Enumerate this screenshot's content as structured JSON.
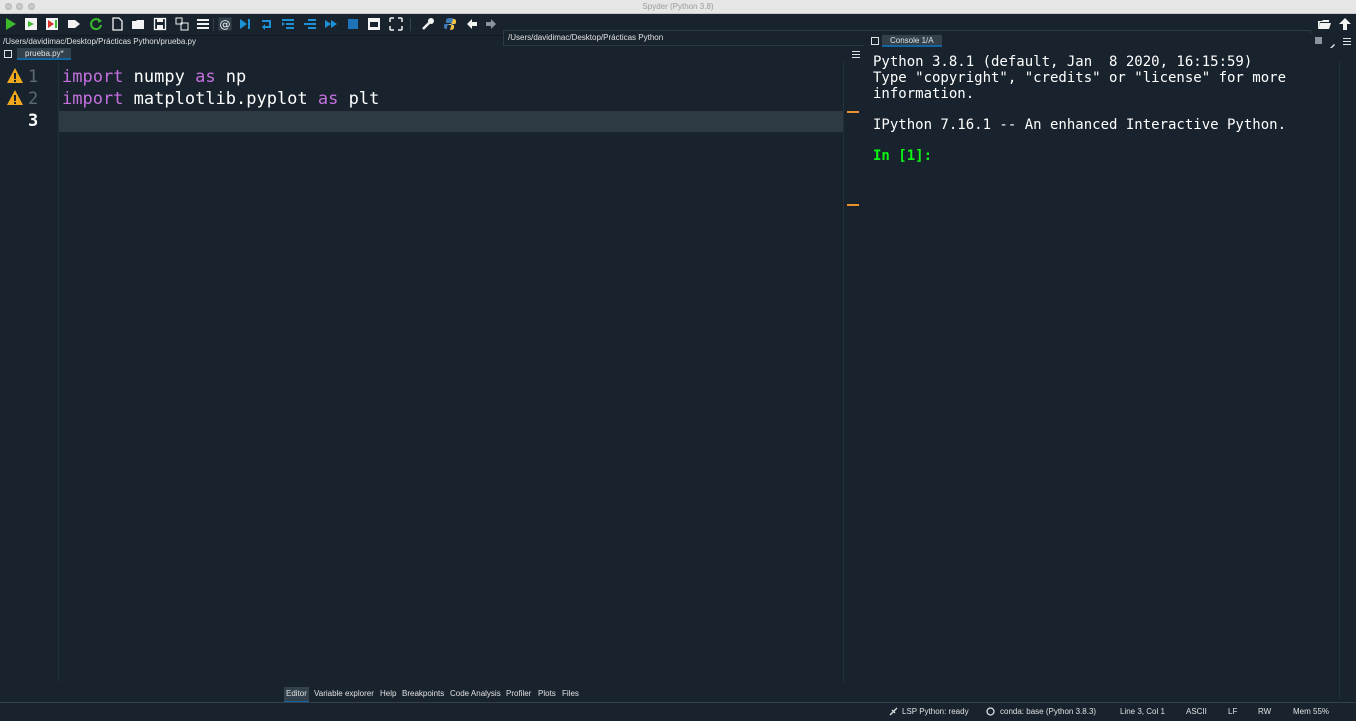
{
  "window": {
    "title": "Spyder (Python 3.8)"
  },
  "toolbar": {
    "path": "/Users/davidimac/Desktop/Prácticas Python",
    "colors": {
      "run": "#3bba2b",
      "debug": "#1d91d6",
      "stop": "#1d72b8",
      "python": "#f6c344"
    }
  },
  "editor": {
    "file_path": "/Users/davidimac/Desktop/Prácticas Python/prueba.py",
    "tab_label": "prueba.py*",
    "lines": [
      {
        "number": "1",
        "warning": true,
        "t1": "import",
        "t2": " numpy ",
        "t3": "as",
        "t4": " np"
      },
      {
        "number": "2",
        "warning": true,
        "t1": "import",
        "t2": " matplotlib.pyplot ",
        "t3": "as",
        "t4": " plt"
      },
      {
        "number": "3",
        "warning": false,
        "t1": "",
        "t2": "",
        "t3": "",
        "t4": ""
      }
    ],
    "colors": {
      "keyword": "#c670e0",
      "marker": "#e8922b",
      "warning": "#f0a81c"
    }
  },
  "console": {
    "tab_label": "Console 1/A",
    "lines": [
      "Python 3.8.1 (default, Jan  8 2020, 16:15:59)",
      "Type \"copyright\", \"credits\" or \"license\" for more",
      "information.",
      "IPython 7.16.1 -- An enhanced Interactive Python."
    ],
    "prompt": "In [1]:",
    "prompt_color": "#0cf512"
  },
  "bottom_tabs": [
    "Editor",
    "Variable explorer",
    "Help",
    "Breakpoints",
    "Code Analysis",
    "Profiler",
    "Plots",
    "Files"
  ],
  "status": {
    "lsp": "LSP Python: ready",
    "conda": "conda: base (Python 3.8.3)",
    "position": "Line 3, Col 1",
    "encoding": "ASCII",
    "eol": "LF",
    "mode": "RW",
    "memory": "Mem 55%"
  }
}
